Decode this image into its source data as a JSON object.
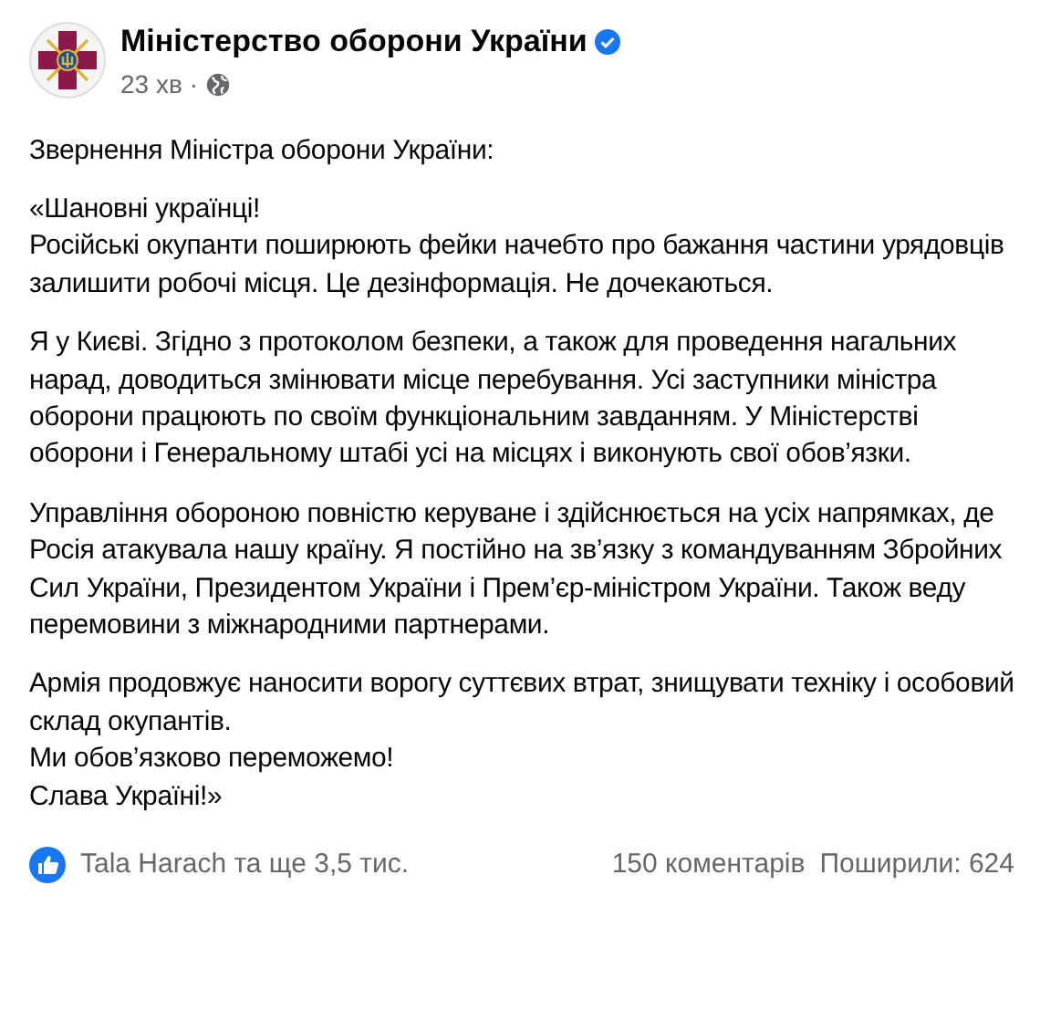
{
  "post": {
    "author": "Міністерство оборони України",
    "verified": true,
    "time": "23 хв",
    "separator": "·",
    "paragraphs": [
      "Звернення Міністра оборони України:",
      "«Шановні українці!\nРосійські окупанти поширюють фейки начебто про бажання частини урядовців залишити робочі місця. Це дезінформація. Не дочекаються.",
      "Я у Києві. Згідно з протоколом безпеки, а також для проведення нагальних нарад, доводиться змінювати місце перебування. Усі заступники міністра оборони працюють по своїм функціональним завданням. У Міністерстві оборони і Генеральному штабі усі на місцях і виконують свої обов’язки.",
      "Управління обороною повністю керуване і здійснюється на усіх напрямках, де Росія атакувала нашу країну. Я постійно на зв’язку з командуванням Збройних Сил України, Президентом України і Прем’єр-міністром України. Також веду перемовини з міжнародними партнерами.",
      "Армія продовжує наносити ворогу суттєвих втрат, знищувати техніку і особовий склад окупантів.\nМи обов’язково переможемо!\nСлава Україні!»"
    ],
    "reactions": "Tala Harach та ще 3,5 тис.",
    "comments": "150 коментарів",
    "shares": "Поширили: 624"
  }
}
